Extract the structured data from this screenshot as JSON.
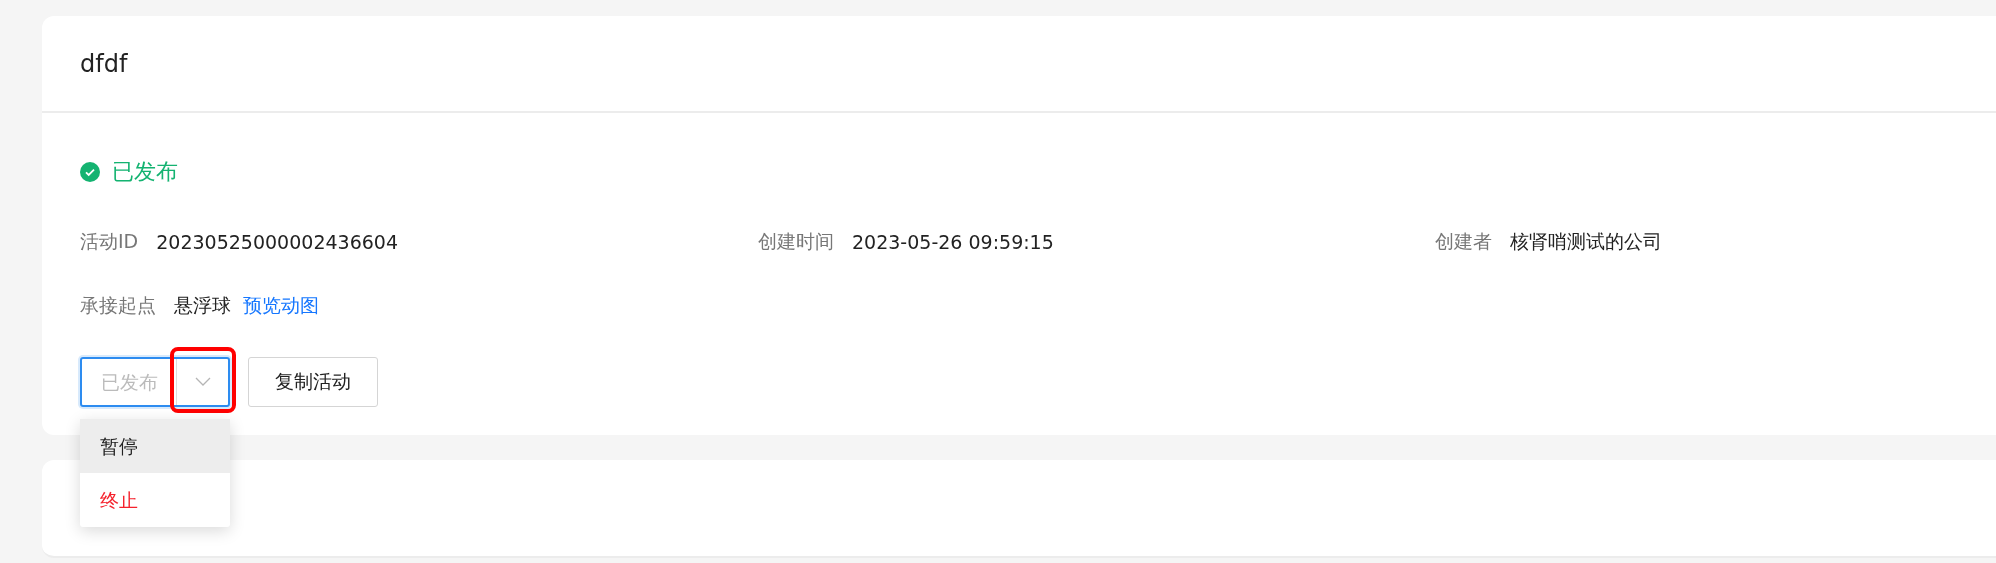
{
  "card": {
    "title": "dfdf"
  },
  "status": {
    "label": "已发布",
    "kind": "success"
  },
  "fields": [
    {
      "label": "活动ID",
      "value": "20230525000002436604"
    },
    {
      "label": "创建时间",
      "value": "2023-05-26 09:59:15"
    },
    {
      "label": "创建者",
      "value": "核肾哨测试的公司"
    }
  ],
  "entry": {
    "label": "承接起点",
    "value": "悬浮球",
    "link": "预览动图"
  },
  "status_select": {
    "value": "已发布",
    "highlighted": true
  },
  "copy_button": {
    "label": "复制活动"
  },
  "menu": [
    {
      "label": "暂停",
      "kind": "normal",
      "selected": true
    },
    {
      "label": "终止",
      "kind": "danger",
      "selected": false
    }
  ]
}
